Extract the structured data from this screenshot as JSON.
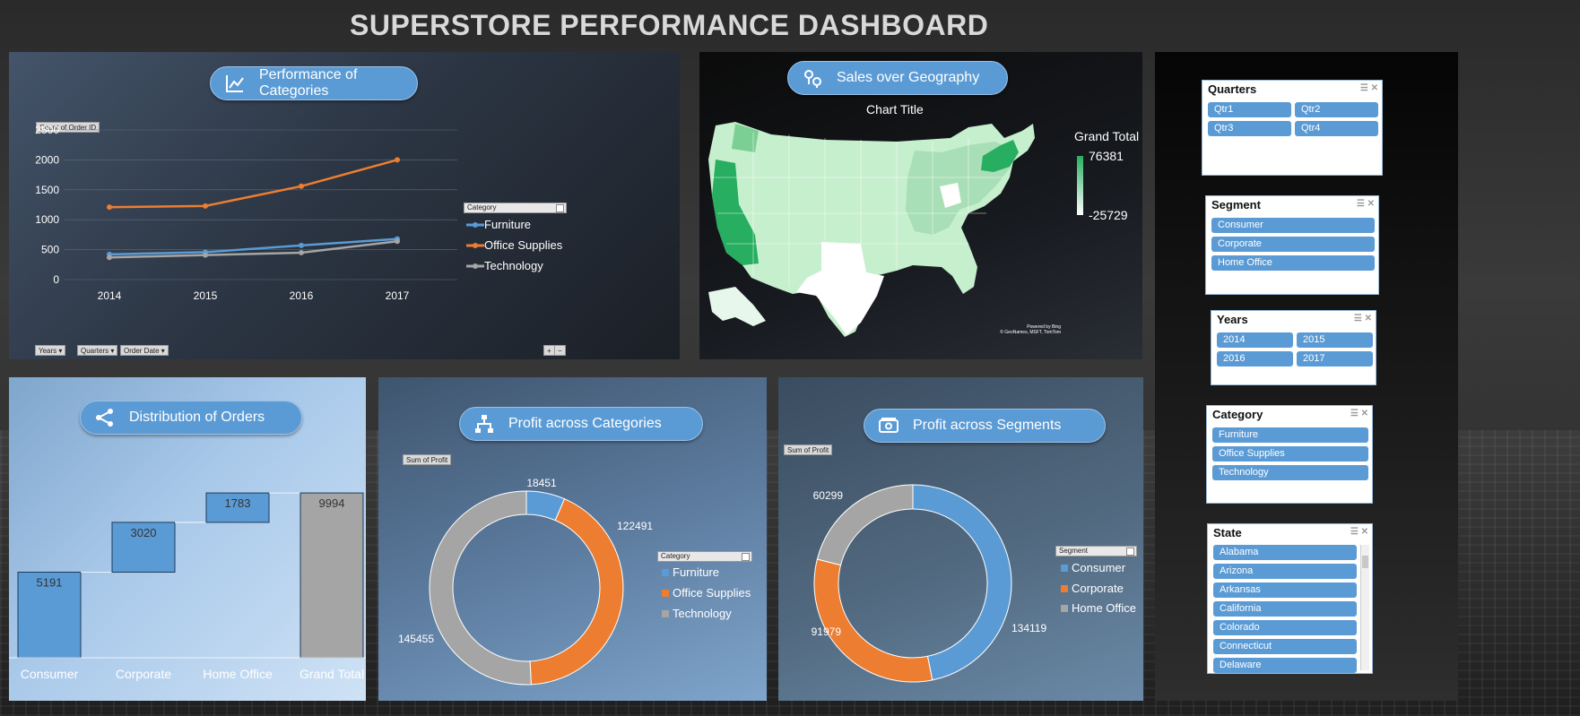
{
  "title": "SUPERSTORE PERFORMANCE DASHBOARD",
  "colors": {
    "blue": "#5b9bd5",
    "orange": "#ed7d31",
    "gray": "#a5a5a5"
  },
  "panels": {
    "categories": {
      "title": "Performance of Categories",
      "icon": "line-chart-icon"
    },
    "geography": {
      "title": "Sales over Geography",
      "icon": "map-pins-icon",
      "chart_title": "Chart Title",
      "legend_title": "Grand Total",
      "max": "76381",
      "min": "-25729",
      "credit1": "Powered by Bing",
      "credit2": "© GeoNames, MSFT, TomTom"
    },
    "distribution": {
      "title": "Distribution of Orders",
      "icon": "share-icon"
    },
    "profit_categories": {
      "title": "Profit across Categories",
      "icon": "hierarchy-icon",
      "field": "Sum of Profit",
      "legend_field": "Category"
    },
    "profit_segments": {
      "title": "Profit across Segments",
      "icon": "money-icon",
      "field": "Sum of Profit",
      "legend_field": "Segment"
    }
  },
  "line_chart_fields": {
    "value_field": "Count of Order ID",
    "axis_fields": [
      "Years",
      "Quarters",
      "Order Date"
    ],
    "legend_field": "Category",
    "zoom": [
      "+",
      "−"
    ]
  },
  "chart_data": [
    {
      "type": "line",
      "title": "",
      "ylabel": "Count of Order ID",
      "x": [
        "2014",
        "2015",
        "2016",
        "2017"
      ],
      "ylim": [
        0,
        2500
      ],
      "yticks": [
        "0",
        "500",
        "1000",
        "1500",
        "2000",
        "2500"
      ],
      "series": [
        {
          "name": "Furniture",
          "values": [
            421,
            458,
            570,
            680
          ]
        },
        {
          "name": "Office Supplies",
          "values": [
            1210,
            1230,
            1560,
            2000
          ]
        },
        {
          "name": "Technology",
          "values": [
            370,
            410,
            450,
            640
          ]
        }
      ],
      "legend": "right"
    },
    {
      "type": "bar",
      "subtype": "waterfall",
      "categories": [
        "Consumer",
        "Corporate",
        "Home Office",
        "Grand Total"
      ],
      "values": [
        5191,
        3020,
        1783,
        9994
      ]
    },
    {
      "type": "pie",
      "subtype": "doughnut",
      "field": "Sum of Profit",
      "categories": [
        "Furniture",
        "Office Supplies",
        "Technology"
      ],
      "values": [
        18451,
        122491,
        145455
      ],
      "labels": [
        "18451",
        "122491",
        "145455"
      ]
    },
    {
      "type": "pie",
      "subtype": "doughnut",
      "field": "Sum of Profit",
      "categories": [
        "Consumer",
        "Corporate",
        "Home Office"
      ],
      "values": [
        134119,
        91979,
        60299
      ],
      "labels": [
        "134119",
        "91979",
        "60299"
      ]
    }
  ],
  "slicers": {
    "quarters": {
      "title": "Quarters",
      "items": [
        "Qtr1",
        "Qtr2",
        "Qtr3",
        "Qtr4"
      ]
    },
    "segment": {
      "title": "Segment",
      "items": [
        "Consumer",
        "Corporate",
        "Home Office"
      ]
    },
    "years": {
      "title": "Years",
      "items": [
        "2014",
        "2015",
        "2016",
        "2017"
      ]
    },
    "category": {
      "title": "Category",
      "items": [
        "Furniture",
        "Office Supplies",
        "Technology"
      ]
    },
    "state": {
      "title": "State",
      "items": [
        "Alabama",
        "Arizona",
        "Arkansas",
        "California",
        "Colorado",
        "Connecticut",
        "Delaware"
      ]
    }
  }
}
